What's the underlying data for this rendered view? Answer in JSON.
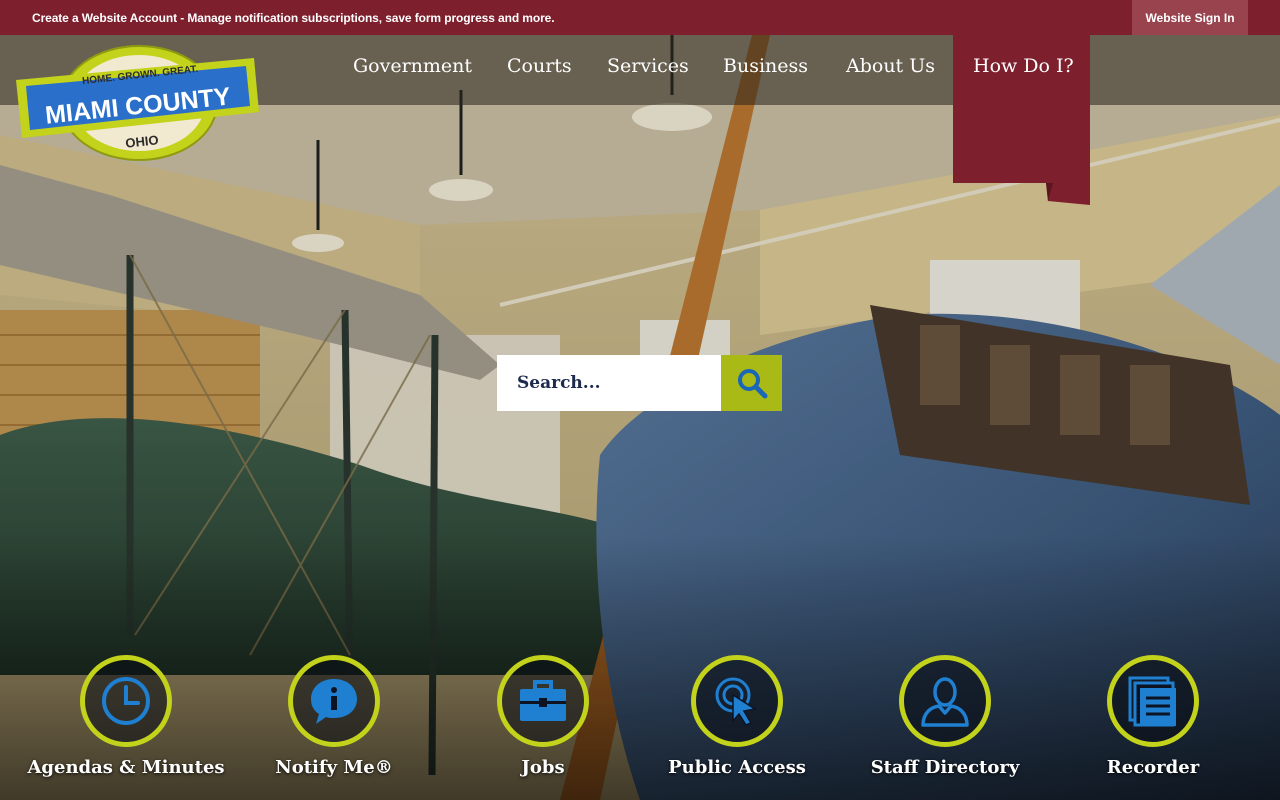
{
  "topbar": {
    "account_link": "Create a Website Account",
    "separator": " - ",
    "message": "Manage notification subscriptions, save form progress and more.",
    "signin": "Website Sign In"
  },
  "logo": {
    "arc_text": "HOME. GROWN. GREAT.",
    "name": "MIAMI COUNTY",
    "state": "OHIO"
  },
  "nav": {
    "items": [
      "Government",
      "Courts",
      "Services",
      "Business",
      "About Us"
    ],
    "how_do_i": "How Do I?"
  },
  "search": {
    "placeholder": "Search..."
  },
  "quick_links": [
    {
      "label": "Agendas & Minutes",
      "icon": "clock-icon"
    },
    {
      "label": "Notify Me®",
      "icon": "info-bubble-icon"
    },
    {
      "label": "Jobs",
      "icon": "briefcase-icon"
    },
    {
      "label": "Public Access",
      "icon": "cursor-click-icon"
    },
    {
      "label": "Staff Directory",
      "icon": "person-icon"
    },
    {
      "label": "Recorder",
      "icon": "documents-icon"
    }
  ],
  "colors": {
    "topbar": "#7d1f2d",
    "accent_green": "#c3d21a",
    "search_button": "#a9b916",
    "icon_blue": "#1f7fd1",
    "nav_highlight": "#7d1f2d"
  }
}
